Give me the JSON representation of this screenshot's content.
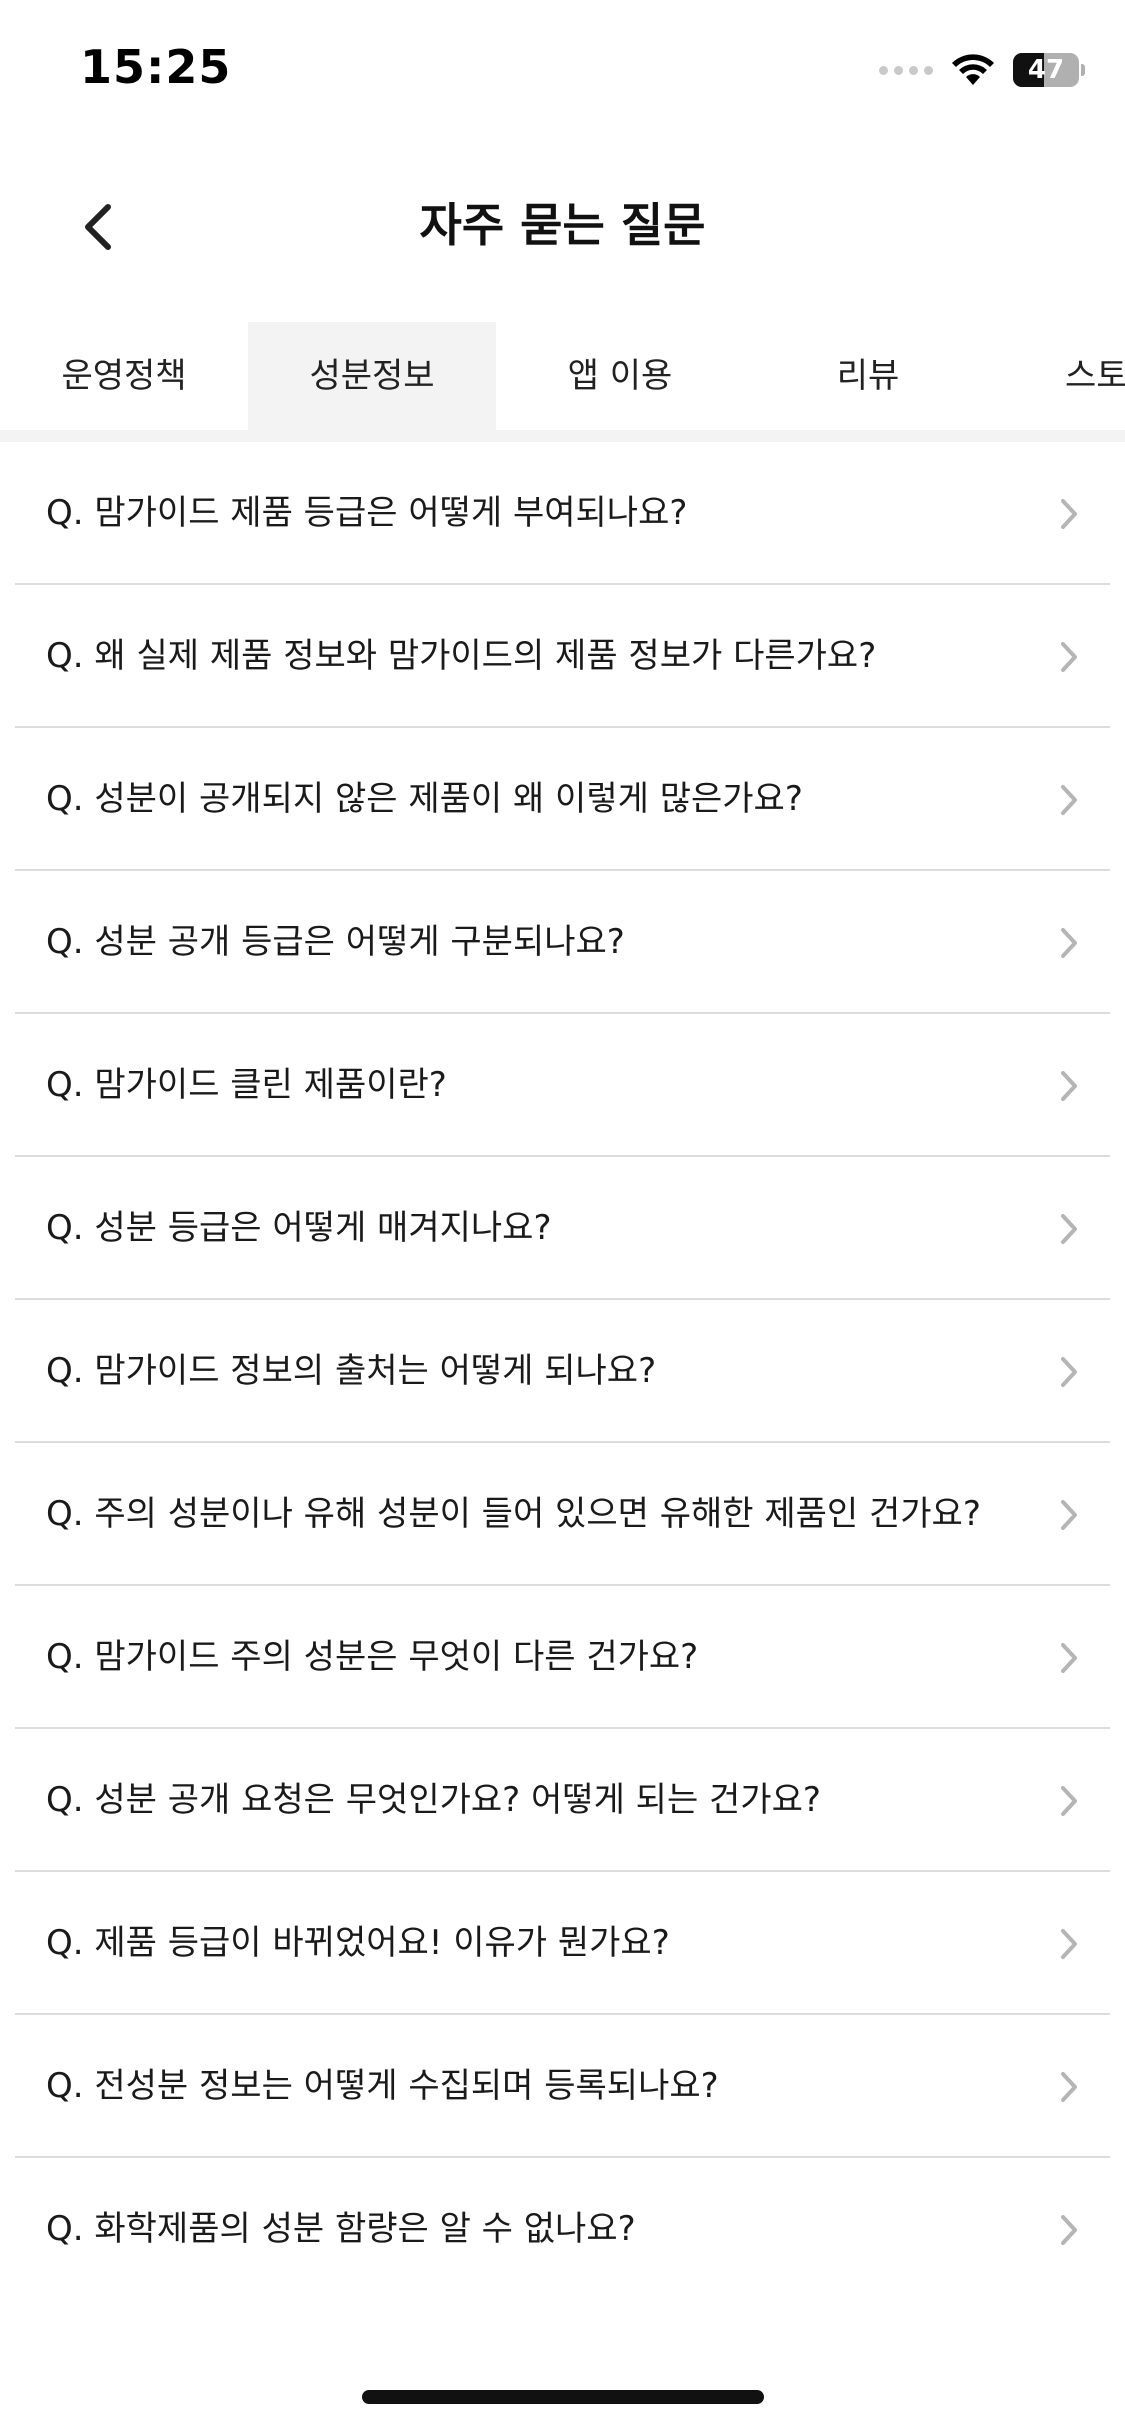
{
  "status_bar": {
    "time": "15:25",
    "battery_level": "47",
    "battery_fraction": 0.47
  },
  "header": {
    "title": "자주 묻는 질문",
    "back_icon": "chevron-left-icon"
  },
  "tabs": [
    {
      "label": "운영정책",
      "active": false
    },
    {
      "label": "성분정보",
      "active": true
    },
    {
      "label": "앱 이용",
      "active": false
    },
    {
      "label": "리뷰",
      "active": false
    },
    {
      "label": "스토어",
      "active": false
    }
  ],
  "faq": {
    "items": [
      "Q. 맘가이드 제품 등급은 어떻게 부여되나요?",
      "Q. 왜 실제 제품 정보와 맘가이드의 제품 정보가 다른가요?",
      "Q. 성분이 공개되지 않은 제품이 왜 이렇게 많은가요?",
      "Q. 성분 공개 등급은 어떻게 구분되나요?",
      "Q. 맘가이드 클린 제품이란?",
      "Q. 성분 등급은 어떻게 매겨지나요?",
      "Q. 맘가이드 정보의 출처는 어떻게 되나요?",
      "Q. 주의 성분이나 유해 성분이 들어 있으면 유해한 제품인 건가요?",
      "Q. 맘가이드 주의 성분은 무엇이 다른 건가요?",
      "Q. 성분 공개 요청은 무엇인가요? 어떻게 되는 건가요?",
      "Q. 제품 등급이 바뀌었어요! 이유가 뭔가요?",
      "Q. 전성분 정보는 어떻게 수집되며 등록되나요?",
      "Q. 화학제품의 성분 함량은 알 수 없나요?"
    ],
    "item_icon": "chevron-right-icon"
  },
  "colors": {
    "active_tab_bg": "#f3f3f3",
    "divider": "#dcdcdc",
    "chevron": "#b5b5b5",
    "text": "#1a1a1a"
  }
}
